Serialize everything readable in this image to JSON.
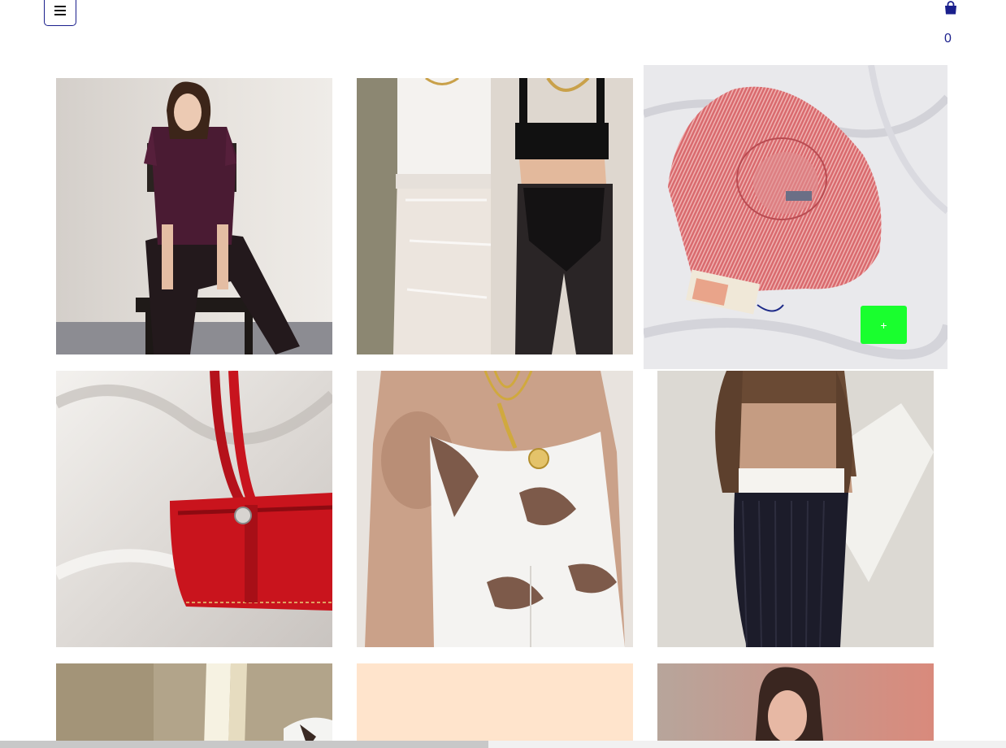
{
  "header": {
    "menu_icon": "hamburger-icon",
    "cart_icon": "shopping-bag-icon",
    "cart_count": "0",
    "accent_color": "#1a1f8c"
  },
  "grid": {
    "items": [
      {
        "subject": "woman-burgundy-blouse-on-chair"
      },
      {
        "subject": "two-models-lace-tights"
      },
      {
        "subject": "pink-striped-bustier-top",
        "hovered": true,
        "add_button_label": "+",
        "add_button_color": "#19ff2e"
      },
      {
        "subject": "red-leather-handbag"
      },
      {
        "subject": "cow-print-corset-with-gold-necklaces"
      },
      {
        "subject": "black-knit-pencil-skirt"
      },
      {
        "subject": "lamp-with-animal-print"
      },
      {
        "subject": "peach-placeholder"
      },
      {
        "subject": "woman-portrait-red-wall"
      }
    ]
  },
  "scroll": {
    "position_fraction": 0.49
  }
}
